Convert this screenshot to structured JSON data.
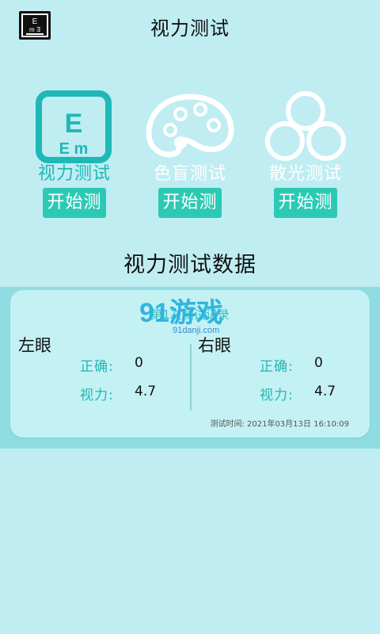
{
  "header": {
    "title": "视力测试",
    "logo_icon": "eye-chart-icon"
  },
  "tests": [
    {
      "label": "视力测试",
      "button": "开始测",
      "icon": "eye-chart-icon",
      "selected": true
    },
    {
      "label": "色盲测试",
      "button": "开始测",
      "icon": "palette-icon",
      "selected": false
    },
    {
      "label": "散光测试",
      "button": "开始测",
      "icon": "circles-icon",
      "selected": false
    }
  ],
  "data_section": {
    "title": "视力测试数据",
    "record": {
      "title": "第1次测试记录",
      "left": {
        "title": "左眼",
        "correct_label": "正确:",
        "correct_value": "0",
        "vision_label": "视力:",
        "vision_value": "4.7"
      },
      "right": {
        "title": "右眼",
        "correct_label": "正确:",
        "correct_value": "0",
        "vision_label": "视力:",
        "vision_value": "4.7"
      },
      "time": "测试时间: 2021年03月13日 16:10:09"
    }
  },
  "watermark": {
    "brand": "91游戏",
    "site": "91danji.com"
  },
  "colors": {
    "background": "#bfedf2",
    "accent": "#1fb8b6",
    "button": "#2ccab5",
    "card": "#c4f1f4",
    "band": "#8fdde2"
  }
}
